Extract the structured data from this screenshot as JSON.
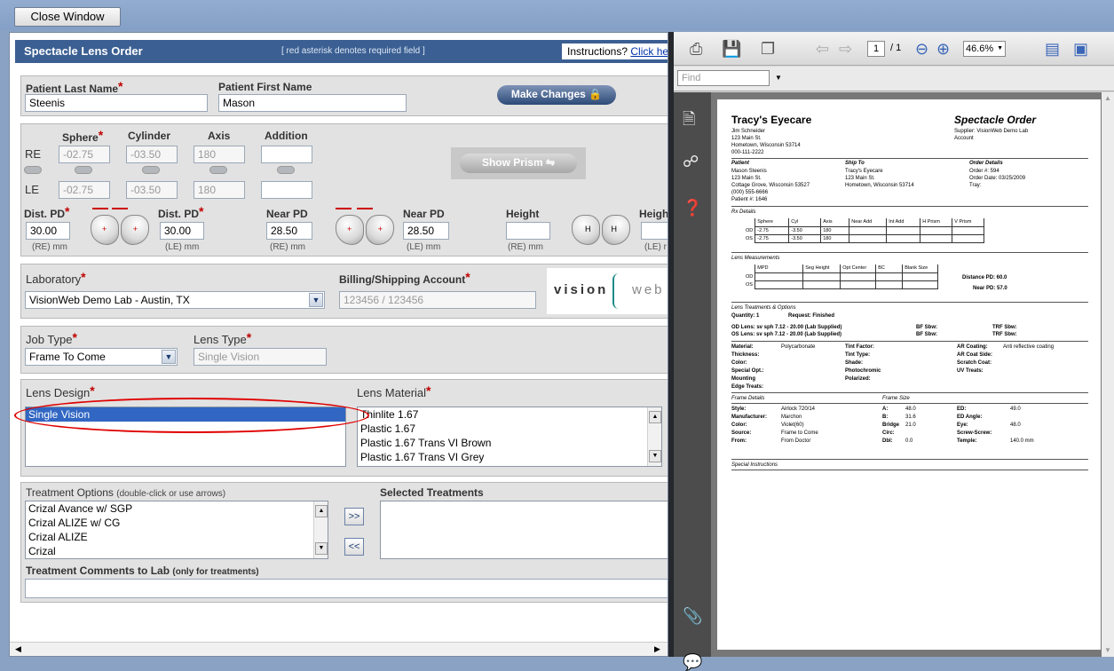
{
  "window": {
    "close_label": "Close Window"
  },
  "form": {
    "title": "Spectacle Lens Order",
    "note": "[ red asterisk denotes required field ]",
    "instructions_label": "Instructions?",
    "instructions_link": "Click here",
    "req_mark": "*",
    "patient": {
      "last_label": "Patient Last Name",
      "first_label": "Patient First Name",
      "last_value": "Steenis",
      "first_value": "Mason",
      "make_changes": "Make Changes"
    },
    "rx": {
      "sphere_label": "Sphere",
      "cylinder_label": "Cylinder",
      "axis_label": "Axis",
      "addition_label": "Addition",
      "re_label": "RE",
      "le_label": "LE",
      "re": {
        "sphere": "-02.75",
        "cylinder": "-03.50",
        "axis": "180",
        "addition": ""
      },
      "le": {
        "sphere": "-02.75",
        "cylinder": "-03.50",
        "axis": "180",
        "addition": ""
      },
      "show_prism": "Show Prism",
      "dist_pd_label": "Dist. PD",
      "near_pd_label": "Near PD",
      "height_label": "Height",
      "height_label2": "Heigh",
      "re_dist_pd": "30.00",
      "le_dist_pd": "30.00",
      "re_near_pd": "28.50",
      "le_near_pd": "28.50",
      "re_mm": "(RE) mm",
      "le_mm": "(LE) mm",
      "le_mm_cut": "(LE) r",
      "lens_plus": "+",
      "lens_h": "H"
    },
    "lab": {
      "label": "Laboratory",
      "value": "VisionWeb Demo Lab - Austin, TX",
      "billing_label": "Billing/Shipping Account",
      "billing_value": "123456 / 123456",
      "logo_left": "vision",
      "logo_right": "web"
    },
    "job": {
      "job_label": "Job Type",
      "job_value": "Frame To Come",
      "lens_type_label": "Lens Type",
      "lens_type_value": "Single Vision"
    },
    "design": {
      "label": "Lens Design",
      "items": [
        "Single Vision"
      ],
      "material_label": "Lens Material",
      "materials": [
        "Thinlite 1.67",
        "Plastic 1.67",
        "Plastic 1.67 Trans VI Brown",
        "Plastic 1.67 Trans VI Grey"
      ]
    },
    "treat": {
      "label": "Treatment Options",
      "label_note": "(double-click or use arrows)",
      "items": [
        "Crizal Avance w/ SGP",
        "Crizal ALIZE w/ CG",
        "Crizal ALIZE",
        "Crizal"
      ],
      "selected_label": "Selected Treatments",
      "add_btn": ">>",
      "remove_btn": "<<",
      "comments_label": "Treatment Comments to Lab",
      "comments_note": "(only for treatments)"
    }
  },
  "viewer": {
    "page_current": "1",
    "page_total": "/ 1",
    "zoom": "46.6%",
    "find_placeholder": "Find",
    "doc": {
      "company": "Tracy's Eyecare",
      "doc_title": "Spectacle Order",
      "company_lines": [
        "Jim Schneider",
        "123 Main St.",
        "Hometown, Wisconsin 53714",
        "000-111-2222"
      ],
      "supplier": "Supplier:  VisionWeb Demo Lab",
      "account": "Account",
      "patient_hdr": "Patient",
      "shipto_hdr": "Ship To",
      "order_hdr": "Order Details",
      "patient_lines": [
        "Mason Steenis",
        "123 Main St.",
        "Cottage Grove, Wisconsin 53527",
        "(000) 555-6666",
        "Patient #:  1646"
      ],
      "shipto_lines": [
        "Tracy's Eyecare",
        "123 Main St.",
        "Hometown, Wisconsin 53714"
      ],
      "order_lines": [
        "Order #:       594",
        "Order Date:  03/25/2009",
        "Tray:"
      ],
      "rx_hdr": "Rx Details",
      "rx_cols": [
        "",
        "Sphere",
        "Cyl",
        "Axis",
        "Near Add",
        "Int Add",
        "H Prism",
        "V Prism"
      ],
      "rx_rows": [
        [
          "OD",
          "-2.75",
          "-3.50",
          "180",
          "",
          "",
          "",
          ""
        ],
        [
          "OS",
          "-2.75",
          "-3.50",
          "180",
          "",
          "",
          "",
          ""
        ]
      ],
      "meas_hdr": "Lens Measurements",
      "meas_cols": [
        "",
        "MPD",
        "Seg Height",
        "Opt Center",
        "BC",
        "Blank Size"
      ],
      "meas_rows": [
        [
          "OD",
          "",
          "",
          "",
          "",
          ""
        ],
        [
          "OS",
          "",
          "",
          "",
          "",
          ""
        ]
      ],
      "distance_pd": "Distance PD:  60.0",
      "near_pd": "Near PD:  57.0",
      "treat_hdr": "Lens Treatments & Options",
      "quantity": "Quantity:  1",
      "request": "Request:  Finished",
      "od_lens": "OD Lens:  sv sph 7.12 - 20.00 (Lab Supplied)",
      "os_lens": "OS Lens:  sv sph 7.12 - 20.00 (Lab Supplied)",
      "bf_sbw": "BF Sbw:",
      "trf_sbw": "TRF Sbw:",
      "mat_col1": [
        "Material:",
        "Thickness:",
        "Color:",
        "Special Opt.:",
        "Mounting",
        "Edge Treats:"
      ],
      "mat_val1": [
        "Polycarbonate",
        "",
        "",
        "",
        "",
        ""
      ],
      "mat_col2": [
        "Tint Factor:",
        "Tint Type:",
        "Shade:",
        "Photochromic",
        "Polarized:"
      ],
      "mat_col3": [
        "AR Coating:",
        "AR Coat Side:",
        "Scratch Coat:",
        "UV Treats:"
      ],
      "mat_val3": [
        "Anti reflective coating",
        "",
        "",
        ""
      ],
      "frame_hdr": "Frame Details",
      "frame_size_hdr": "Frame Size",
      "frame_labels": [
        "Style:",
        "Manufacturer:",
        "Color:",
        "Source:",
        "From:"
      ],
      "frame_values": [
        "Airlock 720/14",
        "Marchon",
        "Violet(60)",
        "Frame to Come",
        "From Doctor"
      ],
      "size_labels": [
        "A:",
        "B:",
        "Bridge",
        "Circ:",
        "Dbl:"
      ],
      "size_values": [
        "48.0",
        "31.6",
        "21.0",
        "",
        "0.0"
      ],
      "size2_labels": [
        "ED:",
        "ED Angle:",
        "Eye:",
        "Screw-Screw:",
        "Temple:"
      ],
      "size2_values": [
        "49.0",
        "",
        "48.0",
        "",
        "140.0 mm"
      ],
      "special_hdr": "Special Instructions"
    }
  },
  "colors": {
    "header_bg": "#3b5f92",
    "required": "#c00000",
    "selection": "#3166c2",
    "annotation": "#e00000"
  }
}
